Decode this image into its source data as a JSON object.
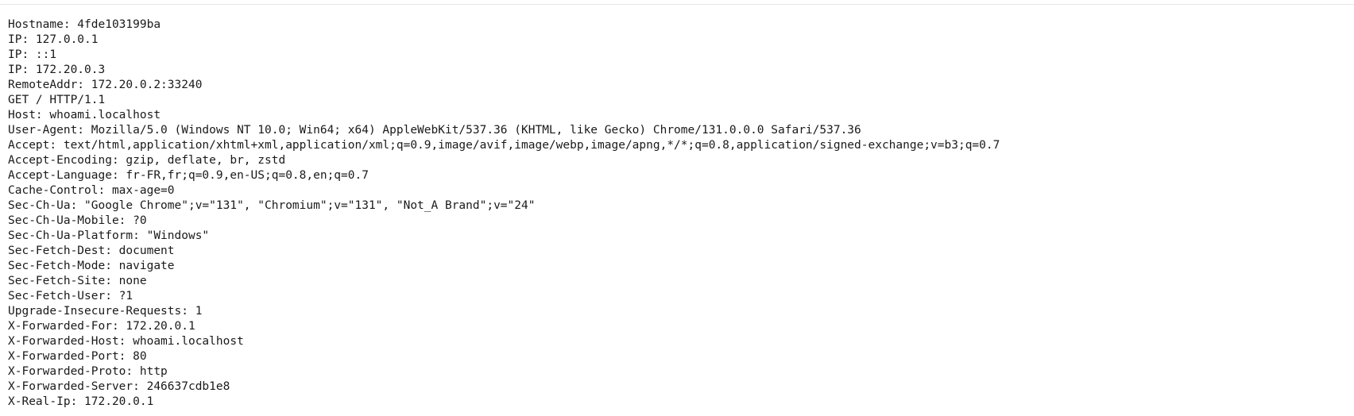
{
  "lines": [
    "Hostname: 4fde103199ba",
    "IP: 127.0.0.1",
    "IP: ::1",
    "IP: 172.20.0.3",
    "RemoteAddr: 172.20.0.2:33240",
    "GET / HTTP/1.1",
    "Host: whoami.localhost",
    "User-Agent: Mozilla/5.0 (Windows NT 10.0; Win64; x64) AppleWebKit/537.36 (KHTML, like Gecko) Chrome/131.0.0.0 Safari/537.36",
    "Accept: text/html,application/xhtml+xml,application/xml;q=0.9,image/avif,image/webp,image/apng,*/*;q=0.8,application/signed-exchange;v=b3;q=0.7",
    "Accept-Encoding: gzip, deflate, br, zstd",
    "Accept-Language: fr-FR,fr;q=0.9,en-US;q=0.8,en;q=0.7",
    "Cache-Control: max-age=0",
    "Sec-Ch-Ua: \"Google Chrome\";v=\"131\", \"Chromium\";v=\"131\", \"Not_A Brand\";v=\"24\"",
    "Sec-Ch-Ua-Mobile: ?0",
    "Sec-Ch-Ua-Platform: \"Windows\"",
    "Sec-Fetch-Dest: document",
    "Sec-Fetch-Mode: navigate",
    "Sec-Fetch-Site: none",
    "Sec-Fetch-User: ?1",
    "Upgrade-Insecure-Requests: 1",
    "X-Forwarded-For: 172.20.0.1",
    "X-Forwarded-Host: whoami.localhost",
    "X-Forwarded-Port: 80",
    "X-Forwarded-Proto: http",
    "X-Forwarded-Server: 246637cdb1e8",
    "X-Real-Ip: 172.20.0.1"
  ]
}
